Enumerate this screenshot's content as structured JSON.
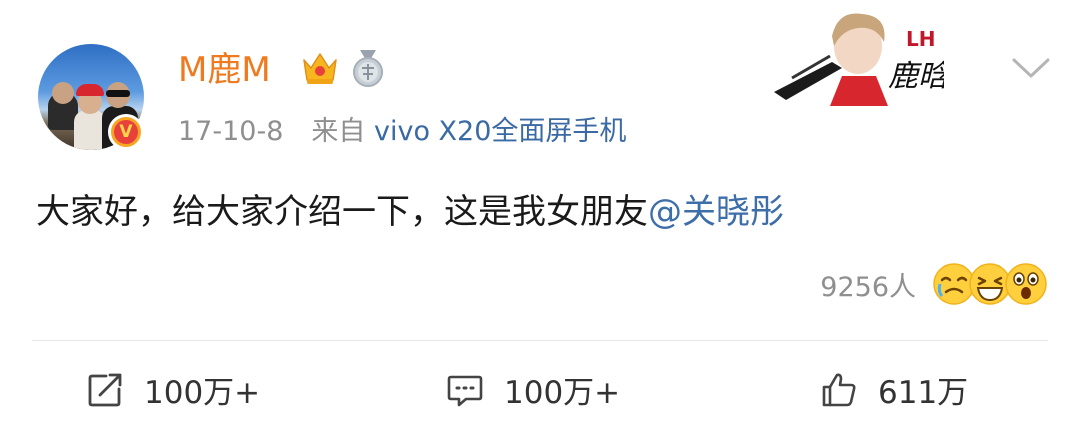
{
  "post": {
    "user": {
      "name": "M鹿M",
      "badge_icons": [
        "crown-icon",
        "medal-icon"
      ],
      "verified_badge_letter": "V"
    },
    "date": "17-10-8",
    "source_prefix": "来自",
    "source_device": "vivo X20全面屏手机",
    "content_text": "大家好，给大家介绍一下，这是我女朋友",
    "mention": "@关晓彤",
    "reactions": {
      "count": "9256人",
      "emojis": [
        "crying-laugh-emoji",
        "laughing-emoji",
        "surprised-emoji"
      ]
    },
    "actions": {
      "repost": "100万+",
      "comment": "100万+",
      "like": "611万"
    }
  },
  "colors": {
    "username": "#ef7a1f",
    "link": "#3d6ea9",
    "meta": "#8f8f8f"
  }
}
